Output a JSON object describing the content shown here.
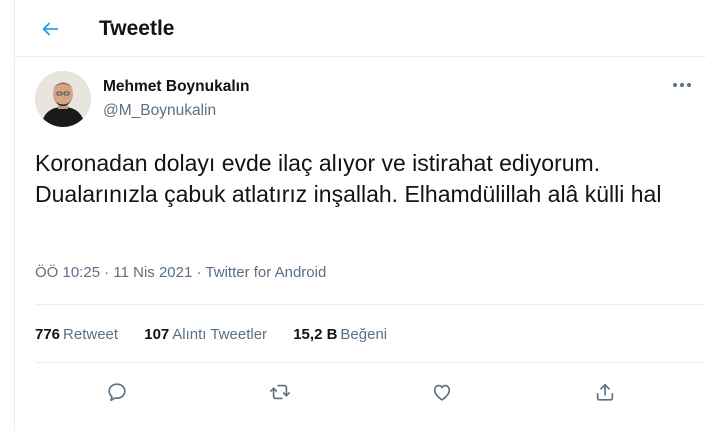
{
  "header": {
    "title": "Tweetle",
    "back_icon": "arrow-left-icon",
    "accent_color": "#1da1f2"
  },
  "author": {
    "name": "Mehmet Boynukalın",
    "handle": "@M_Boynukalin",
    "avatar_icon": "user-avatar"
  },
  "tweet": {
    "text": "Koronadan dolayı evde ilaç alıyor ve istirahat ediyorum. Dualarınızla çabuk atlatırız inşallah. Elhamdülillah alâ külli hal",
    "time": "ÖÖ 10:25",
    "date": "11 Nis 2021",
    "separator": "·",
    "source": "Twitter for Android"
  },
  "stats": {
    "retweets_count": "776",
    "retweets_label": "Retweet",
    "quotes_count": "107",
    "quotes_label": "Alıntı Tweetler",
    "likes_count": "15,2 B",
    "likes_label": "Beğeni"
  },
  "actions": {
    "reply_icon": "reply-icon",
    "retweet_icon": "retweet-icon",
    "like_icon": "heart-icon",
    "share_icon": "share-icon"
  },
  "colors": {
    "text_primary": "#0f1419",
    "text_secondary": "#5b7083",
    "border": "#ebeef0"
  }
}
